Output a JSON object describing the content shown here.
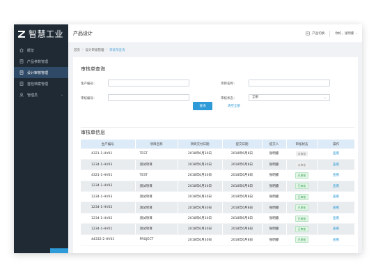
{
  "brand": {
    "name": "智慧工业"
  },
  "header": {
    "page_title": "产品设计",
    "product_switch": "产品切换",
    "user_greeting": "你好，张明睿"
  },
  "nav": {
    "items": [
      {
        "label": "概览",
        "icon": "home-icon",
        "active": false
      },
      {
        "label": "产品参数管理",
        "icon": "document-icon",
        "active": false
      },
      {
        "label": "设计审核管理",
        "icon": "document-icon",
        "active": true
      },
      {
        "label": "首检档案管理",
        "icon": "document-icon",
        "active": false
      },
      {
        "label": "管理员",
        "icon": "user-icon",
        "active": false,
        "expandable": true
      }
    ]
  },
  "breadcrumb": {
    "home": "首页",
    "parent": "设计审核管理",
    "current": "审核单查询"
  },
  "query": {
    "title": "审核单查询",
    "production_no_label": "生产编号：",
    "production_no_value": "",
    "project_name_label": "项目名称：",
    "project_name_value": "",
    "audit_no_label": "审核编号：",
    "audit_no_value": "",
    "audit_status_label": "审核状态：",
    "audit_status_value": "全部",
    "query_button": "查询",
    "clear_button": "清空全部"
  },
  "results": {
    "title": "审核单信息",
    "columns": [
      "生产编号",
      "项目名称",
      "项目交付日期",
      "提交日期",
      "提交人",
      "审核状态",
      "操作"
    ],
    "rows": [
      {
        "no": "4321-1-HV01",
        "name": "TEST",
        "delivery": "2018年6月30日",
        "submitted": "2018年6月8日",
        "submitter": "张明睿",
        "status": "未审核",
        "status_type": "pending",
        "action": "查看"
      },
      {
        "no": "1234-1-HV03",
        "name": "测试项目",
        "delivery": "2018年6月30日",
        "submitted": "2018年6月8日",
        "submitter": "张明睿",
        "status": "未审核",
        "status_type": "pending",
        "action": "查看"
      },
      {
        "no": "4321-1-HV01",
        "name": "TEST",
        "delivery": "2018年6月30日",
        "submitted": "2018年6月8日",
        "submitter": "张明睿",
        "status": "已审核",
        "status_type": "passed",
        "action": "查看"
      },
      {
        "no": "1234-1-HV03",
        "name": "测试项目",
        "delivery": "2018年6月30日",
        "submitted": "2018年6月8日",
        "submitter": "张明睿",
        "status": "已审核",
        "status_type": "passed",
        "action": "查看"
      },
      {
        "no": "1234-1-HV03",
        "name": "测试项目",
        "delivery": "2018年6月30日",
        "submitted": "2018年6月8日",
        "submitter": "张明睿",
        "status": "已审核",
        "status_type": "passed",
        "action": "查看"
      },
      {
        "no": "1234-1-HV02",
        "name": "测试项目",
        "delivery": "2018年6月30日",
        "submitted": "2018年6月8日",
        "submitter": "张明睿",
        "status": "已审核",
        "status_type": "passed",
        "action": "查看"
      },
      {
        "no": "1234-1-HV02",
        "name": "测试项目",
        "delivery": "2018年6月30日",
        "submitted": "2018年6月8日",
        "submitter": "张明睿",
        "status": "已审核",
        "status_type": "passed",
        "action": "查看"
      },
      {
        "no": "1234-1-HV01",
        "name": "测试项目",
        "delivery": "2018年6月30日",
        "submitted": "2018年6月8日",
        "submitter": "张明睿",
        "status": "已审核",
        "status_type": "passed",
        "action": "查看"
      },
      {
        "no": "44332-2-HV01",
        "name": "PROJECT",
        "delivery": "2018年6月30日",
        "submitted": "2018年6月8日",
        "submitter": "张明睿",
        "status": "已审核",
        "status_type": "passed",
        "action": "查看"
      }
    ]
  },
  "colors": {
    "sidebar_bg": "#1f2a35",
    "active_nav": "#2f4a66",
    "accent": "#2e9bd8",
    "table_header": "#ddeaf7",
    "passed_green": "#3aa657"
  }
}
